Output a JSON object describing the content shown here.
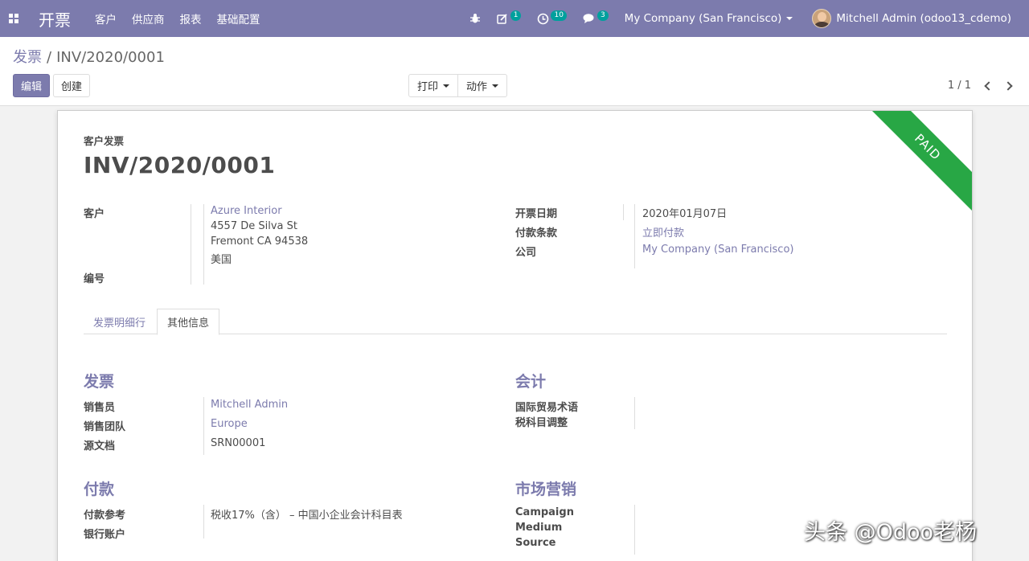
{
  "navbar": {
    "app_title": "开票",
    "menu": [
      "客户",
      "供应商",
      "报表",
      "基础配置"
    ],
    "activity_count": "1",
    "timer_count": "10",
    "chat_count": "3",
    "company": "My Company (San Francisco)",
    "user": "Mitchell Admin (odoo13_cdemo)",
    "bar_color": "#7c7bad"
  },
  "breadcrumb": {
    "parent": "发票",
    "separator": "/",
    "current": "INV/2020/0001"
  },
  "buttons": {
    "edit": "编辑",
    "create": "创建",
    "print": "打印",
    "action": "动作"
  },
  "pager": {
    "value": "1 / 1"
  },
  "sheet": {
    "ribbon": "PAID",
    "ribbon_color": "#28a745",
    "doc_type": "客户发票",
    "title": "INV/2020/0001",
    "labels": {
      "customer": "客户",
      "reference": "编号",
      "invoice_date": "开票日期",
      "payment_terms": "付款条款",
      "company": "公司"
    },
    "customer": {
      "name": "Azure Interior",
      "street": "4557 De Silva St",
      "city": "Fremont CA 94538",
      "country": "美国"
    },
    "invoice_date": "2020年01月07日",
    "payment_terms": "立即付款",
    "company": "My Company (San Francisco)",
    "tabs": [
      "发票明细行",
      "其他信息"
    ],
    "invoice_section": {
      "title": "发票",
      "salesperson_label": "销售员",
      "salesperson": "Mitchell Admin",
      "team_label": "销售团队",
      "team": "Europe",
      "origin_label": "源文档",
      "origin": "SRN00001"
    },
    "accounting_section": {
      "title": "会计",
      "incoterm_label": "国际贸易术语",
      "fiscal_position_label": "税科目调整"
    },
    "payment_section": {
      "title": "付款",
      "payment_ref_label": "付款参考",
      "payment_ref": "税收17%（含） – 中国小企业会计科目表",
      "bank_label": "银行账户"
    },
    "marketing_section": {
      "title": "市场营销",
      "campaign_label": "Campaign",
      "medium_label": "Medium",
      "source_label": "Source"
    }
  },
  "watermark": "头条 @Odoo老杨"
}
